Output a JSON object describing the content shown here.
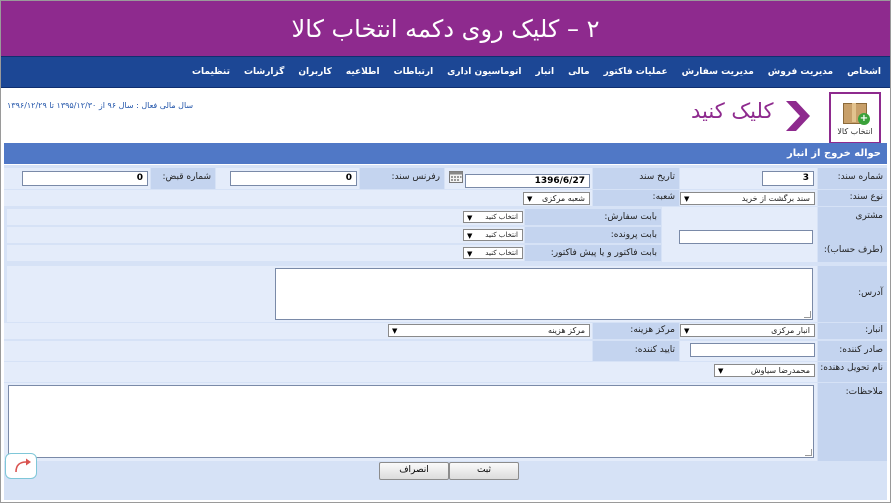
{
  "banner": {
    "title": "۲ – کلیک روی دکمه انتخاب کالا"
  },
  "menu": {
    "items": [
      "اشخاص",
      "مدیریت فروش",
      "مدیریت سفارش",
      "عملیات فاکتور",
      "مالی",
      "انبار",
      "اتوماسیون اداری",
      "ارتباطات",
      "اطلاعیه",
      "کاربران",
      "گزارشات",
      "تنظیمات"
    ]
  },
  "fiscal_year": "سال مالی فعال : سال ۹۶ از ۱۳۹۵/۱۲/۳۰ تا ۱۳۹۶/۱۲/۲۹",
  "select_goods": {
    "label": "انتخاب کالا",
    "icon": "package-add-icon"
  },
  "hint": {
    "text": "کلیک کنید",
    "icon": "chevron-right-icon"
  },
  "form": {
    "title": "حواله خروج از انبار",
    "doc_number_label": "شماره سند:",
    "doc_number_value": "3",
    "doc_date_label": "تاریخ سند",
    "doc_date_value": "1396/6/27",
    "reference_label": "رفرنس سند:",
    "reference_value": "0",
    "receipt_label": "شماره قبض:",
    "receipt_value": "0",
    "doc_type_label": "نوع سند:",
    "doc_type_value": "سند برگشت از خرید",
    "branch_label": "شعبه:",
    "branch_value": "شعبه مرکزی",
    "customer_label": "مشتری",
    "account_side_label": "(طرف حساب):",
    "order_label": "بابت سفارش:",
    "case_label": "بابت پرونده:",
    "invoice_label": "بابت فاکتور و یا پیش فاکتور:",
    "select_placeholder": "انتخاب کنید",
    "address_label": "آدرس:",
    "warehouse_label": "انبار:",
    "warehouse_value": "انبار مرکزی",
    "cost_center_label": "مرکز هزینه:",
    "cost_center_value": "مرکز هزینه",
    "issuer_label": "صادر کننده:",
    "approver_label": "تایید کننده:",
    "deliverer_label": "نام تحویل دهنده:",
    "deliverer_value": "محمدرضا سیاوش",
    "notes_label": "ملاحظات:",
    "submit_label": "ثبت",
    "cancel_label": "انصراف"
  },
  "colors": {
    "accent": "#8e2a8e",
    "nav": "#1c4795",
    "header": "#5078c6"
  }
}
